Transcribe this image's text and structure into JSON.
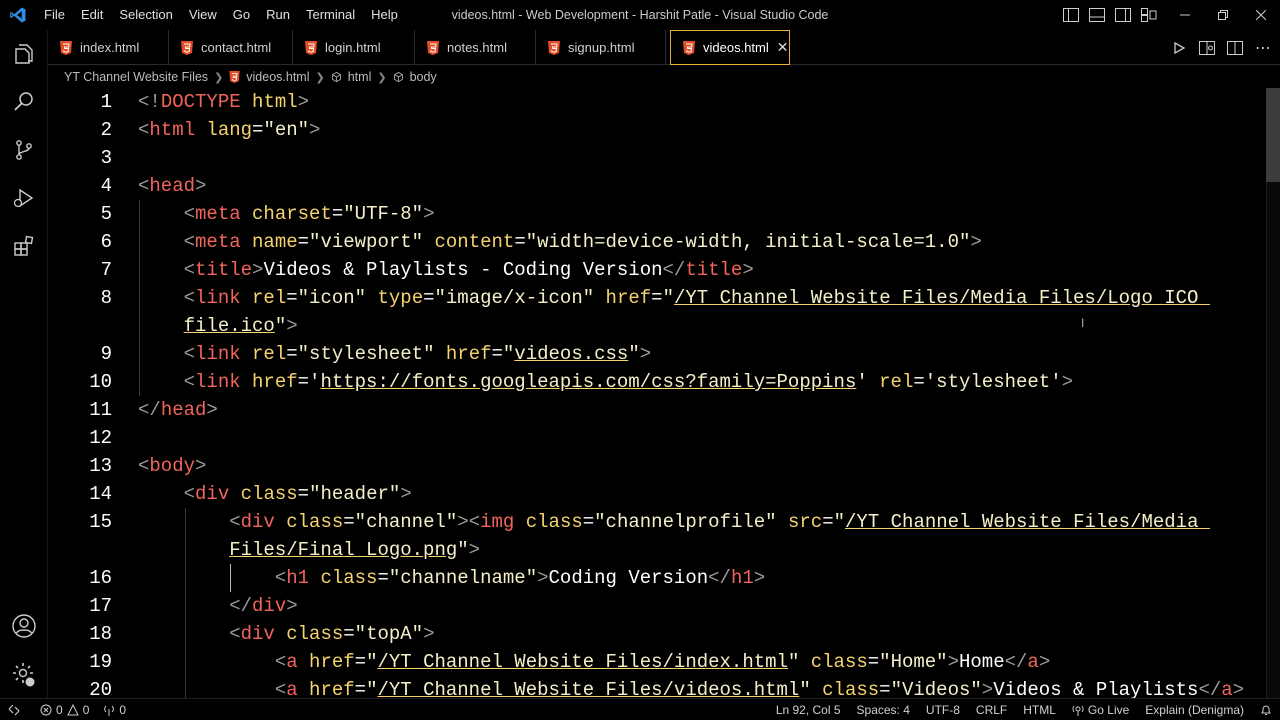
{
  "titlebar": {
    "menu": [
      "File",
      "Edit",
      "Selection",
      "View",
      "Go",
      "Run",
      "Terminal",
      "Help"
    ],
    "title": "videos.html - Web Development - Harshit Patle - Visual Studio Code"
  },
  "tabs": [
    {
      "label": "index.html",
      "active": false
    },
    {
      "label": "contact.html",
      "active": false
    },
    {
      "label": "login.html",
      "active": false
    },
    {
      "label": "notes.html",
      "active": false
    },
    {
      "label": "signup.html",
      "active": false
    },
    {
      "label": "videos.html",
      "active": true
    }
  ],
  "breadcrumb": {
    "folder": "YT Channel Website Files",
    "file": "videos.html",
    "element1": "html",
    "element2": "body"
  },
  "editor": {
    "language": "html",
    "lines": [
      {
        "num": "1",
        "tokens": [
          [
            "p",
            "<!"
          ],
          [
            "tag",
            "DOCTYPE"
          ],
          [
            "t",
            " "
          ],
          [
            "attr",
            "html"
          ],
          [
            "p",
            ">"
          ]
        ]
      },
      {
        "num": "2",
        "tokens": [
          [
            "p",
            "<"
          ],
          [
            "tag",
            "html"
          ],
          [
            "t",
            " "
          ],
          [
            "attr",
            "lang"
          ],
          [
            "t",
            "="
          ],
          [
            "str",
            "\"en\""
          ],
          [
            "p",
            ">"
          ]
        ]
      },
      {
        "num": "3",
        "tokens": []
      },
      {
        "num": "4",
        "tokens": [
          [
            "p",
            "<"
          ],
          [
            "tag",
            "head"
          ],
          [
            "p",
            ">"
          ]
        ]
      },
      {
        "num": "5",
        "tokens": [
          [
            "t",
            "    "
          ],
          [
            "p",
            "<"
          ],
          [
            "tag",
            "meta"
          ],
          [
            "t",
            " "
          ],
          [
            "attr",
            "charset"
          ],
          [
            "t",
            "="
          ],
          [
            "str",
            "\"UTF-8\""
          ],
          [
            "p",
            ">"
          ]
        ]
      },
      {
        "num": "6",
        "tokens": [
          [
            "t",
            "    "
          ],
          [
            "p",
            "<"
          ],
          [
            "tag",
            "meta"
          ],
          [
            "t",
            " "
          ],
          [
            "attr",
            "name"
          ],
          [
            "t",
            "="
          ],
          [
            "str",
            "\"viewport\""
          ],
          [
            "t",
            " "
          ],
          [
            "attr",
            "content"
          ],
          [
            "t",
            "="
          ],
          [
            "str",
            "\"width=device-width, initial-scale=1.0\""
          ],
          [
            "p",
            ">"
          ]
        ]
      },
      {
        "num": "7",
        "tokens": [
          [
            "t",
            "    "
          ],
          [
            "p",
            "<"
          ],
          [
            "tag",
            "title"
          ],
          [
            "p",
            ">"
          ],
          [
            "t",
            "Videos & Playlists - Coding Version"
          ],
          [
            "p",
            "</"
          ],
          [
            "tag",
            "title"
          ],
          [
            "p",
            ">"
          ]
        ]
      },
      {
        "num": "8",
        "tokens": [
          [
            "t",
            "    "
          ],
          [
            "p",
            "<"
          ],
          [
            "tag",
            "link"
          ],
          [
            "t",
            " "
          ],
          [
            "attr",
            "rel"
          ],
          [
            "t",
            "="
          ],
          [
            "str",
            "\"icon\""
          ],
          [
            "t",
            " "
          ],
          [
            "attr",
            "type"
          ],
          [
            "t",
            "="
          ],
          [
            "str",
            "\"image/x-icon\""
          ],
          [
            "t",
            " "
          ],
          [
            "attr",
            "href"
          ],
          [
            "t",
            "="
          ],
          [
            "str",
            "\""
          ],
          [
            "link",
            "/YT Channel Website Files/Media Files/Logo ICO "
          ]
        ]
      },
      {
        "num": "",
        "tokens": [
          [
            "t",
            "    "
          ],
          [
            "link",
            "file.ico"
          ],
          [
            "str",
            "\""
          ],
          [
            "p",
            ">"
          ]
        ]
      },
      {
        "num": "9",
        "tokens": [
          [
            "t",
            "    "
          ],
          [
            "p",
            "<"
          ],
          [
            "tag",
            "link"
          ],
          [
            "t",
            " "
          ],
          [
            "attr",
            "rel"
          ],
          [
            "t",
            "="
          ],
          [
            "str",
            "\"stylesheet\""
          ],
          [
            "t",
            " "
          ],
          [
            "attr",
            "href"
          ],
          [
            "t",
            "="
          ],
          [
            "str",
            "\""
          ],
          [
            "link",
            "videos.css"
          ],
          [
            "str",
            "\""
          ],
          [
            "p",
            ">"
          ]
        ]
      },
      {
        "num": "10",
        "tokens": [
          [
            "t",
            "    "
          ],
          [
            "p",
            "<"
          ],
          [
            "tag",
            "link"
          ],
          [
            "t",
            " "
          ],
          [
            "attr",
            "href"
          ],
          [
            "t",
            "="
          ],
          [
            "str",
            "'"
          ],
          [
            "link",
            "https://fonts.googleapis.com/css?family=Poppins"
          ],
          [
            "str",
            "'"
          ],
          [
            "t",
            " "
          ],
          [
            "attr",
            "rel"
          ],
          [
            "t",
            "="
          ],
          [
            "str",
            "'stylesheet'"
          ],
          [
            "p",
            ">"
          ]
        ]
      },
      {
        "num": "11",
        "tokens": [
          [
            "p",
            "</"
          ],
          [
            "tag",
            "head"
          ],
          [
            "p",
            ">"
          ]
        ]
      },
      {
        "num": "12",
        "tokens": []
      },
      {
        "num": "13",
        "tokens": [
          [
            "p",
            "<"
          ],
          [
            "tag",
            "body"
          ],
          [
            "p",
            ">"
          ]
        ]
      },
      {
        "num": "14",
        "tokens": [
          [
            "t",
            "    "
          ],
          [
            "p",
            "<"
          ],
          [
            "tag",
            "div"
          ],
          [
            "t",
            " "
          ],
          [
            "attr",
            "class"
          ],
          [
            "t",
            "="
          ],
          [
            "str",
            "\"header\""
          ],
          [
            "p",
            ">"
          ]
        ]
      },
      {
        "num": "15",
        "tokens": [
          [
            "t",
            "        "
          ],
          [
            "p",
            "<"
          ],
          [
            "tag",
            "div"
          ],
          [
            "t",
            " "
          ],
          [
            "attr",
            "class"
          ],
          [
            "t",
            "="
          ],
          [
            "str",
            "\"channel\""
          ],
          [
            "p",
            "><"
          ],
          [
            "tag",
            "img"
          ],
          [
            "t",
            " "
          ],
          [
            "attr",
            "class"
          ],
          [
            "t",
            "="
          ],
          [
            "str",
            "\"channelprofile\""
          ],
          [
            "t",
            " "
          ],
          [
            "attr",
            "src"
          ],
          [
            "t",
            "="
          ],
          [
            "str",
            "\""
          ],
          [
            "link",
            "/YT Channel Website Files/Media "
          ]
        ]
      },
      {
        "num": "",
        "tokens": [
          [
            "t",
            "        "
          ],
          [
            "link",
            "Files/Final Logo.png"
          ],
          [
            "str",
            "\""
          ],
          [
            "p",
            ">"
          ]
        ]
      },
      {
        "num": "16",
        "tokens": [
          [
            "t",
            "            "
          ],
          [
            "p",
            "<"
          ],
          [
            "tag",
            "h1"
          ],
          [
            "t",
            " "
          ],
          [
            "attr",
            "class"
          ],
          [
            "t",
            "="
          ],
          [
            "str",
            "\"channelname\""
          ],
          [
            "p",
            ">"
          ],
          [
            "t",
            "Coding Version"
          ],
          [
            "p",
            "</"
          ],
          [
            "tag",
            "h1"
          ],
          [
            "p",
            ">"
          ]
        ]
      },
      {
        "num": "17",
        "tokens": [
          [
            "t",
            "        "
          ],
          [
            "p",
            "</"
          ],
          [
            "tag",
            "div"
          ],
          [
            "p",
            ">"
          ]
        ]
      },
      {
        "num": "18",
        "tokens": [
          [
            "t",
            "        "
          ],
          [
            "p",
            "<"
          ],
          [
            "tag",
            "div"
          ],
          [
            "t",
            " "
          ],
          [
            "attr",
            "class"
          ],
          [
            "t",
            "="
          ],
          [
            "str",
            "\"topA\""
          ],
          [
            "p",
            ">"
          ]
        ]
      },
      {
        "num": "19",
        "tokens": [
          [
            "t",
            "            "
          ],
          [
            "p",
            "<"
          ],
          [
            "tag",
            "a"
          ],
          [
            "t",
            " "
          ],
          [
            "attr",
            "href"
          ],
          [
            "t",
            "="
          ],
          [
            "str",
            "\""
          ],
          [
            "link",
            "/YT Channel Website Files/index.html"
          ],
          [
            "str",
            "\""
          ],
          [
            "t",
            " "
          ],
          [
            "attr",
            "class"
          ],
          [
            "t",
            "="
          ],
          [
            "str",
            "\"Home\""
          ],
          [
            "p",
            ">"
          ],
          [
            "t",
            "Home"
          ],
          [
            "p",
            "</"
          ],
          [
            "tag",
            "a"
          ],
          [
            "p",
            ">"
          ]
        ]
      },
      {
        "num": "20",
        "tokens": [
          [
            "t",
            "            "
          ],
          [
            "p",
            "<"
          ],
          [
            "tag",
            "a"
          ],
          [
            "t",
            " "
          ],
          [
            "attr",
            "href"
          ],
          [
            "t",
            "="
          ],
          [
            "str",
            "\""
          ],
          [
            "link",
            "/YT Channel Website Files/videos.html"
          ],
          [
            "str",
            "\""
          ],
          [
            "t",
            " "
          ],
          [
            "attr",
            "class"
          ],
          [
            "t",
            "="
          ],
          [
            "str",
            "\"Videos\""
          ],
          [
            "p",
            ">"
          ],
          [
            "t",
            "Videos & Playlists"
          ],
          [
            "p",
            "</"
          ],
          [
            "tag",
            "a"
          ],
          [
            "p",
            ">"
          ]
        ]
      }
    ]
  },
  "statusbar": {
    "errors": "0",
    "warnings": "0",
    "ports": "0",
    "position": "Ln 92, Col 5",
    "spaces": "Spaces: 4",
    "encoding": "UTF-8",
    "eol": "CRLF",
    "language": "HTML",
    "golive": "Go Live",
    "explain": "Explain (Denigma)"
  },
  "colors": {
    "tag": "#f0645a",
    "attr": "#f5d36b",
    "string": "#f5efc8",
    "active_tab_border": "#e5af3a",
    "html_file_icon": "#e44d26"
  }
}
